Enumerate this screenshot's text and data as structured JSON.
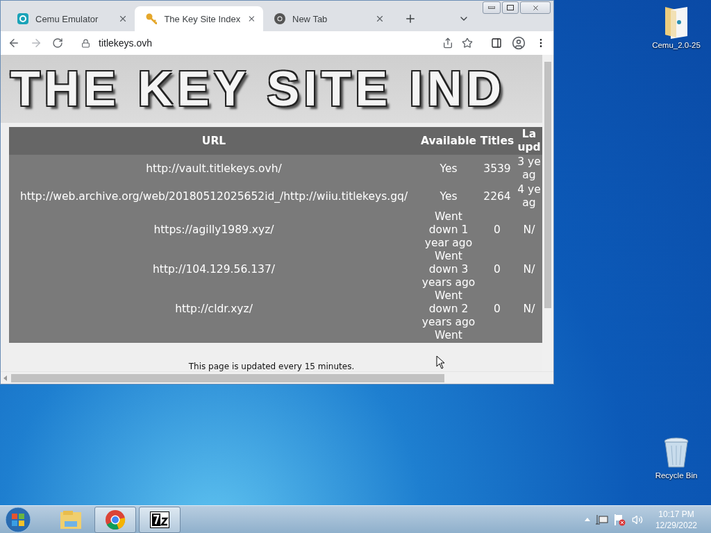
{
  "browser": {
    "tabs": [
      {
        "title": "Cemu Emulator",
        "kind": "cemu",
        "selected": false
      },
      {
        "title": "The Key Site Index",
        "kind": "key",
        "selected": true
      },
      {
        "title": "New Tab",
        "kind": "chrome",
        "selected": false
      }
    ],
    "address": "titlekeys.ovh"
  },
  "page": {
    "banner": "THE KEY SITE IND",
    "table": {
      "columns": [
        "URL",
        "Available",
        "Titles",
        "La upd"
      ],
      "rows": [
        {
          "cells": [
            "http://vault.titlekeys.ovh/",
            "Yes",
            "3539",
            "3 ye ag"
          ]
        },
        {
          "cells": [
            "http://web.archive.org/web/20180512025652id_/http://wiiu.titlekeys.gq/",
            "Yes",
            "2264",
            "4 ye ag"
          ]
        },
        {
          "cells": [
            "https://agilly1989.xyz/",
            "Went down 1 year ago",
            "0",
            "N/"
          ]
        },
        {
          "cells": [
            "http://104.129.56.137/",
            "Went down 3 years ago",
            "0",
            "N/"
          ]
        },
        {
          "cells": [
            "http://cldr.xyz/",
            "Went down 2 years ago",
            "0",
            "N/"
          ]
        },
        {
          "cells": [
            "",
            "Went",
            "",
            ""
          ]
        }
      ]
    },
    "footer": "This page is updated every 15 minutes."
  },
  "desktop_icons": [
    {
      "label": "Cemu_2.0-25",
      "kind": "folder"
    },
    {
      "label": "Recycle Bin",
      "kind": "bin"
    }
  ],
  "taskbar": {
    "apps": [
      {
        "kind": "explorer",
        "selected": false
      },
      {
        "kind": "chrome",
        "selected": true
      },
      {
        "kind": "sevenzip",
        "selected": true
      }
    ],
    "time": "10:17 PM",
    "date": "12/29/2022"
  }
}
